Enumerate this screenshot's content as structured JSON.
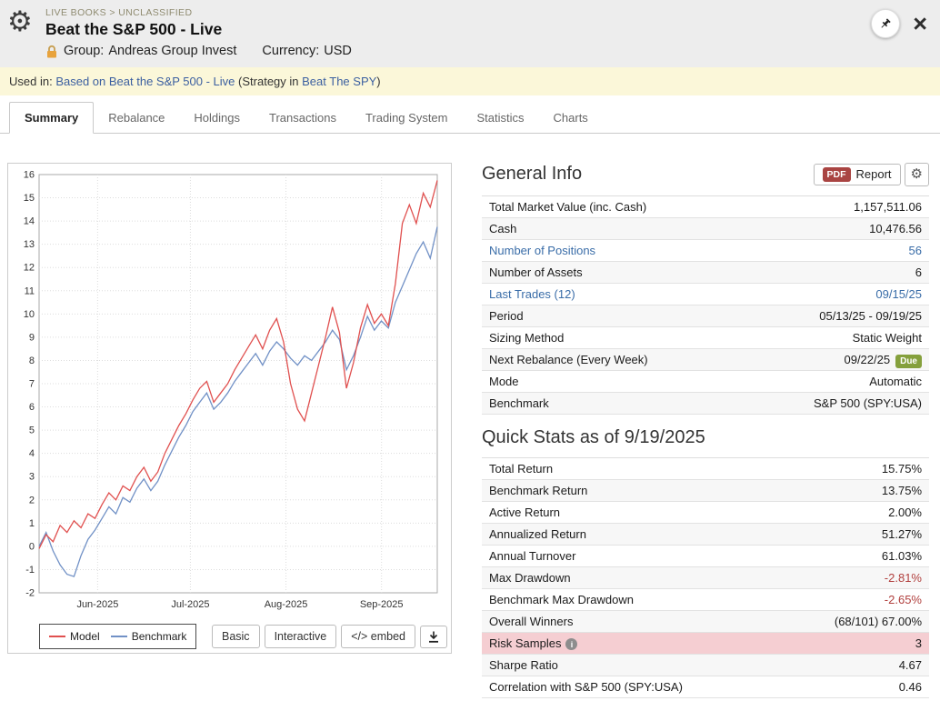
{
  "icons": {
    "gear": "⚙",
    "close": "×"
  },
  "header": {
    "breadcrumb": "LIVE BOOKS > UNCLASSIFIED",
    "title": "Beat the S&P 500 - Live",
    "group_label": "Group:",
    "group_value": "Andreas Group Invest",
    "currency_label": "Currency:",
    "currency_value": "USD"
  },
  "used_in": {
    "prefix": "Used in:",
    "link1": "Based on Beat the S&P 500 - Live",
    "middle": "(Strategy in",
    "link2": "Beat The SPY",
    "suffix": ")"
  },
  "tabs": [
    {
      "label": "Summary",
      "active": true
    },
    {
      "label": "Rebalance",
      "active": false
    },
    {
      "label": "Holdings",
      "active": false
    },
    {
      "label": "Transactions",
      "active": false
    },
    {
      "label": "Trading System",
      "active": false
    },
    {
      "label": "Statistics",
      "active": false
    },
    {
      "label": "Charts",
      "active": false
    }
  ],
  "chart_data": {
    "type": "line",
    "title": "",
    "xlabel": "",
    "ylabel": "",
    "ylim": [
      -2,
      16
    ],
    "ytick_step": 1,
    "grid": true,
    "legend_position": "bottom-left",
    "x_ticks": [
      {
        "label": "Jun-2025",
        "pos": 0.147
      },
      {
        "label": "Jul-2025",
        "pos": 0.38
      },
      {
        "label": "Aug-2025",
        "pos": 0.62
      },
      {
        "label": "Sep-2025",
        "pos": 0.86
      }
    ],
    "x_range": [
      "05/13/25",
      "09/19/25"
    ],
    "series": [
      {
        "name": "Model",
        "color": "#e0504f",
        "values": [
          -0.1,
          0.5,
          0.2,
          0.9,
          0.6,
          1.1,
          0.8,
          1.4,
          1.2,
          1.8,
          2.3,
          2.0,
          2.6,
          2.4,
          3.0,
          3.4,
          2.8,
          3.2,
          4.0,
          4.6,
          5.2,
          5.7,
          6.3,
          6.8,
          7.1,
          6.2,
          6.6,
          7.0,
          7.6,
          8.1,
          8.6,
          9.1,
          8.5,
          9.3,
          9.8,
          8.8,
          7.0,
          5.9,
          5.4,
          6.6,
          7.8,
          9.0,
          10.3,
          9.2,
          6.8,
          7.9,
          9.4,
          10.4,
          9.6,
          10.0,
          9.5,
          11.3,
          13.9,
          14.7,
          13.9,
          15.2,
          14.6,
          15.75
        ]
      },
      {
        "name": "Benchmark",
        "color": "#7191c6",
        "values": [
          0.0,
          0.6,
          -0.2,
          -0.8,
          -1.2,
          -1.3,
          -0.4,
          0.3,
          0.7,
          1.2,
          1.7,
          1.4,
          2.1,
          1.9,
          2.5,
          2.9,
          2.4,
          2.8,
          3.5,
          4.1,
          4.7,
          5.2,
          5.8,
          6.2,
          6.6,
          5.9,
          6.2,
          6.6,
          7.1,
          7.5,
          7.9,
          8.3,
          7.8,
          8.4,
          8.8,
          8.5,
          8.1,
          7.8,
          8.2,
          8.0,
          8.4,
          8.8,
          9.3,
          8.9,
          7.6,
          8.2,
          9.0,
          9.9,
          9.3,
          9.7,
          9.4,
          10.5,
          11.2,
          11.9,
          12.6,
          13.1,
          12.4,
          13.75
        ]
      }
    ]
  },
  "chart_controls": {
    "basic_label": "Basic",
    "interactive_label": "Interactive",
    "embed_label": "</> embed"
  },
  "general_info": {
    "title": "General Info",
    "pdf_badge": "PDF",
    "report_label": "Report",
    "rows": [
      {
        "label": "Total Market Value (inc. Cash)",
        "value": "1,157,511.06"
      },
      {
        "label": "Cash",
        "value": "10,476.56"
      },
      {
        "label": "Number of Positions",
        "value": "56",
        "label_link": true,
        "value_link": true
      },
      {
        "label": "Number of Assets",
        "value": "6"
      },
      {
        "label": "Last Trades (12)",
        "value": "09/15/25",
        "label_link": true,
        "value_link": true
      },
      {
        "label": "Period",
        "value": "05/13/25 - 09/19/25"
      },
      {
        "label": "Sizing Method",
        "value": "Static Weight"
      },
      {
        "label": "Next Rebalance (Every Week)",
        "value": "09/22/25",
        "badge": "Due"
      },
      {
        "label": "Mode",
        "value": "Automatic"
      },
      {
        "label": "Benchmark",
        "value": "S&P 500 (SPY:USA)"
      }
    ]
  },
  "quick_stats": {
    "title": "Quick Stats as of 9/19/2025",
    "rows": [
      {
        "label": "Total Return",
        "value": "15.75%"
      },
      {
        "label": "Benchmark Return",
        "value": "13.75%"
      },
      {
        "label": "Active Return",
        "value": "2.00%"
      },
      {
        "label": "Annualized Return",
        "value": "51.27%"
      },
      {
        "label": "Annual Turnover",
        "value": "61.03%"
      },
      {
        "label": "Max Drawdown",
        "value": "-2.81%",
        "negative": true
      },
      {
        "label": "Benchmark Max Drawdown",
        "value": "-2.65%",
        "negative": true
      },
      {
        "label": "Overall Winners",
        "value": "(68/101) 67.00%"
      },
      {
        "label": "Risk Samples",
        "value": "3",
        "highlight": true,
        "info_icon": true
      },
      {
        "label": "Sharpe Ratio",
        "value": "4.67"
      },
      {
        "label": "Correlation with S&P 500 (SPY:USA)",
        "value": "0.46"
      }
    ]
  }
}
